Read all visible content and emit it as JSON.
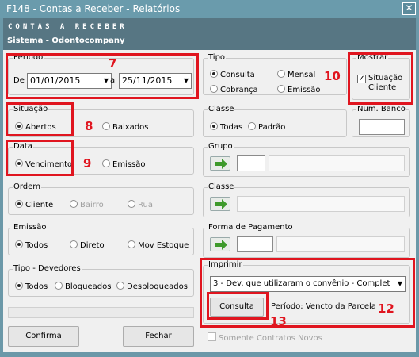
{
  "window": {
    "title": "F148 - Contas a Receber - Relatórios",
    "close_glyph": "✕"
  },
  "header": {
    "title": "CONTAS A RECEBER",
    "subtitle": "Sistema - Odontocompany"
  },
  "periodo": {
    "legend": "Período",
    "from_label": "De",
    "from_value": "01/01/2015",
    "to_label": "a",
    "to_value": "25/11/2015"
  },
  "tipo": {
    "legend": "Tipo",
    "options": [
      "Consulta",
      "Mensal",
      "Cobrança",
      "Emissão"
    ]
  },
  "mostrar": {
    "legend": "Mostrar",
    "checkbox_line1": "Situação",
    "checkbox_line2": "Cliente"
  },
  "situacao": {
    "legend": "Situação",
    "options": [
      "Abertos",
      "Baixados"
    ]
  },
  "classe1": {
    "legend": "Classe",
    "options": [
      "Todas",
      "Padrão"
    ]
  },
  "num_banco": {
    "legend": "Num. Banco"
  },
  "data": {
    "legend": "Data",
    "options": [
      "Vencimento",
      "Emissão"
    ]
  },
  "grupo": {
    "legend": "Grupo"
  },
  "ordem": {
    "legend": "Ordem",
    "options": [
      "Cliente",
      "Bairro",
      "Rua"
    ]
  },
  "classe2": {
    "legend": "Classe"
  },
  "emissao": {
    "legend": "Emissão",
    "options": [
      "Todos",
      "Direto",
      "Mov Estoque"
    ]
  },
  "forma_pagamento": {
    "legend": "Forma de Pagamento"
  },
  "tipo_devedores": {
    "legend": "Tipo - Devedores",
    "options": [
      "Todos",
      "Bloqueados",
      "Desbloqueados"
    ]
  },
  "imprimir": {
    "legend": "Imprimir",
    "selected": "3 - Dev. que utilizaram o convênio - Complet",
    "consulta_button": "Consulta",
    "periodo_text": "Período:  Vencto da Parcela"
  },
  "footer": {
    "confirma": "Confirma",
    "fechar": "Fechar",
    "somente_contratos": "Somente Contratos Novos"
  },
  "annotations": [
    "7",
    "8",
    "9",
    "10",
    "12",
    "13"
  ],
  "colors": {
    "annotation": "#e0151f",
    "titlebar": "#6a9bac",
    "header": "#577683",
    "arrow_green": "#3d9a2a"
  }
}
